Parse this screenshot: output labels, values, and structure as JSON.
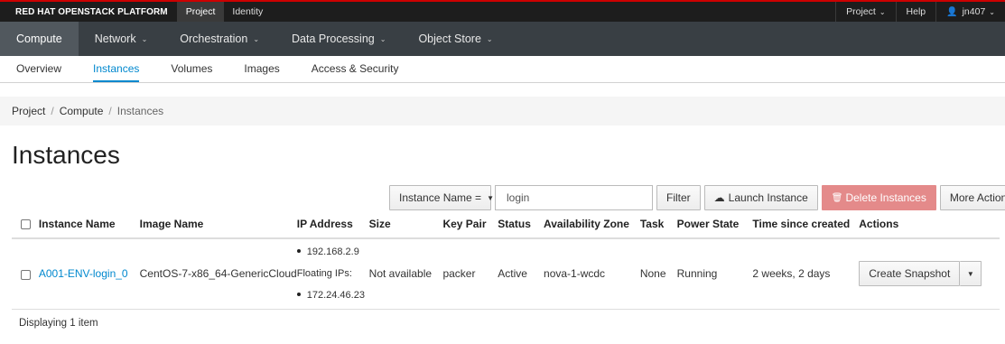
{
  "topbar": {
    "brand": "RED HAT OPENSTACK PLATFORM",
    "tabs": [
      {
        "label": "Project"
      },
      {
        "label": "Identity"
      }
    ],
    "right": {
      "project": "Project",
      "help": "Help",
      "user": "jn407"
    }
  },
  "mainnav": {
    "items": [
      {
        "label": "Compute"
      },
      {
        "label": "Network"
      },
      {
        "label": "Orchestration"
      },
      {
        "label": "Data Processing"
      },
      {
        "label": "Object Store"
      }
    ]
  },
  "subnav": {
    "items": [
      {
        "label": "Overview"
      },
      {
        "label": "Instances"
      },
      {
        "label": "Volumes"
      },
      {
        "label": "Images"
      },
      {
        "label": "Access & Security"
      }
    ]
  },
  "breadcrumb": {
    "items": [
      "Project",
      "Compute",
      "Instances"
    ]
  },
  "page": {
    "title": "Instances"
  },
  "toolbar": {
    "filter_field": "Instance Name =",
    "search_value": "login",
    "filter_button": "Filter",
    "launch_button": "Launch Instance",
    "delete_button": "Delete Instances",
    "more_actions": "More Actions"
  },
  "table": {
    "columns": [
      "Instance Name",
      "Image Name",
      "IP Address",
      "Size",
      "Key Pair",
      "Status",
      "Availability Zone",
      "Task",
      "Power State",
      "Time since created",
      "Actions"
    ],
    "rows": [
      {
        "instance_name": "A001-ENV-login_0",
        "image_name": "CentOS-7-x86_64-GenericCloud",
        "ip_address": "192.168.2.9",
        "floating_label": "Floating IPs:",
        "floating_ip": "172.24.46.23",
        "size": "Not available",
        "key_pair": "packer",
        "status": "Active",
        "availability_zone": "nova-1-wcdc",
        "task": "None",
        "power_state": "Running",
        "time_since_created": "2 weeks, 2 days",
        "action": "Create Snapshot"
      }
    ]
  },
  "footer": {
    "text": "Displaying 1 item"
  },
  "icons": {
    "user": "user-icon",
    "launch": "cloud-upload-icon",
    "delete": "trash-icon",
    "caret": "chevron-down-icon"
  },
  "colors": {
    "accent": "#0088ce",
    "danger": "#e48a8a",
    "topbar_border": "#cc0000",
    "nav_bg": "#393f44"
  }
}
